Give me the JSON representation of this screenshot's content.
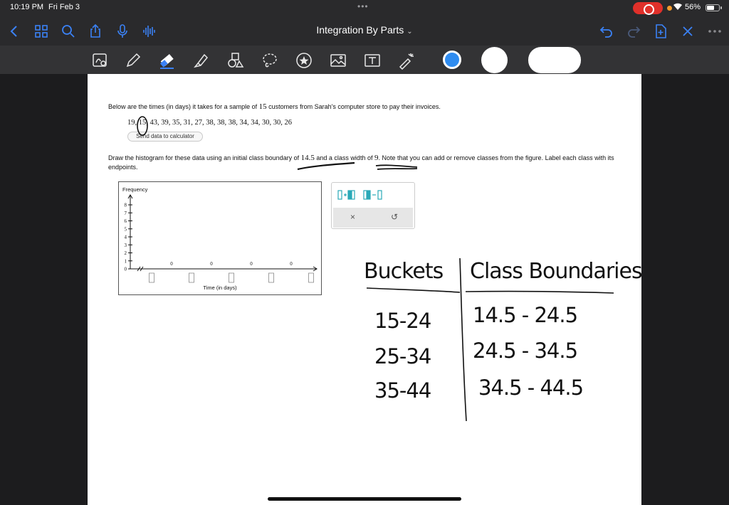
{
  "status_bar": {
    "time": "10:19 PM",
    "date": "Fri Feb 3",
    "battery": "56%"
  },
  "nav": {
    "title": "Integration By Parts"
  },
  "toolbar": {
    "tools": [
      "lasso-zoom",
      "pen",
      "eraser",
      "highlighter",
      "shapes",
      "lasso",
      "sticker",
      "image",
      "text",
      "laser-pointer"
    ],
    "swatches": [
      "#2f8cf0",
      "#ffffff",
      "#ffffff"
    ]
  },
  "question": {
    "intro_before": "Below are the times (in days) it takes for a sample of ",
    "sample_size": "15",
    "intro_after": " customers from Sarah's computer store to pay their invoices.",
    "data_text": "19, 15, 43, 39, 35, 31, 27, 38, 38, 38, 34, 34, 30, 30, 26",
    "send_button": "Send data to calculator",
    "instr_1": "Draw the histogram for these data using an initial class boundary of ",
    "boundary": "14.5",
    "instr_2": " and a class width of ",
    "width": "9",
    "instr_3": ". Note that you can add or remove classes from the figure. Label each class with its endpoints."
  },
  "chart_data": {
    "type": "bar",
    "ylabel": "Frequency",
    "xlabel": "Time (in days)",
    "y_ticks": [
      0,
      1,
      2,
      3,
      4,
      5,
      6,
      7,
      8
    ],
    "ylim": [
      0,
      8
    ],
    "values": [
      0,
      0,
      0,
      0
    ]
  },
  "class_tools": {
    "close": "×",
    "reset": "↺"
  },
  "notes": {
    "col1_header": "Buckets",
    "col2_header": "Class Boundaries",
    "rows": [
      {
        "bucket": "15-24",
        "boundary": "14.5 - 24.5"
      },
      {
        "bucket": "25-34",
        "boundary": "24.5 - 34.5"
      },
      {
        "bucket": "35-44",
        "boundary": "34.5 - 44.5"
      }
    ]
  }
}
